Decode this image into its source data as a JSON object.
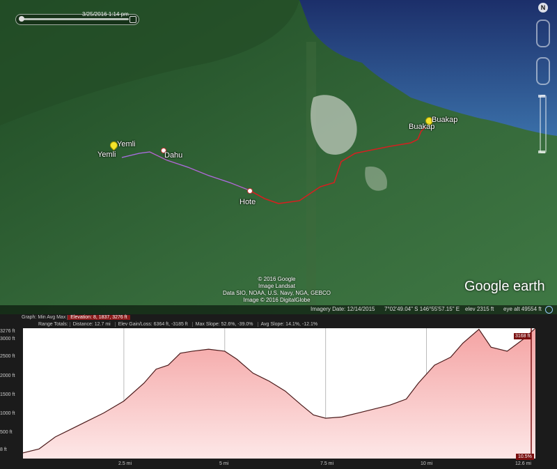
{
  "timeline": {
    "date": "3/25/2016",
    "time": "1:14 pm"
  },
  "nav": {
    "north": "N"
  },
  "places": {
    "yemli_top": "Yemli",
    "yemli_bottom": "Yemli",
    "dahu": "Dahu",
    "hote": "Hote",
    "buakap_top": "Buakap",
    "buakap_bottom": "Buakap"
  },
  "credits": [
    "© 2016 Google",
    "Image Landsat",
    "Data SIO, NOAA, U.S. Navy, NGA, GEBCO",
    "Image © 2016 DigitalGlobe"
  ],
  "logo": "Google earth",
  "status": {
    "imagery": "Imagery Date: 12/14/2015",
    "coords": "7°02'49.04\" S  146°55'57.15\" E",
    "elev": "elev  2315 ft",
    "eye": "eye alt  49554 ft"
  },
  "profile": {
    "row1": {
      "graph": "Graph:",
      "min": "Min",
      "avg": "Avg",
      "max": "Max",
      "elevation": "Elevation: 8, 1837, 3276 ft"
    },
    "row2": {
      "range": "Range Totals:",
      "distance": "Distance: 12.7 mi",
      "gain": "Elev Gain/Loss: 6364 ft, -3185 ft",
      "maxslope": "Max Slope: 52.6%, -39.0%",
      "avgslope": "Avg Slope: 14.1%, -12.1%"
    },
    "current_value": "3168 ft",
    "current_slope": "10.5%"
  },
  "chart_data": {
    "type": "area",
    "ylabel_ticks": [
      "3276 ft",
      "3000 ft",
      "2500 ft",
      "2000 ft",
      "1500 ft",
      "1000 ft",
      "500 ft",
      "8 ft"
    ],
    "xticks": [
      "2.5 mi",
      "5 mi",
      "7.5 mi",
      "10 mi",
      "12.6 mi"
    ],
    "ylim": [
      8,
      3276
    ],
    "xlim": [
      0,
      12.7
    ],
    "x": [
      0,
      0.4,
      0.8,
      1.2,
      1.6,
      2.0,
      2.5,
      3.0,
      3.3,
      3.6,
      3.9,
      4.2,
      4.6,
      5.0,
      5.3,
      5.7,
      6.1,
      6.5,
      6.9,
      7.2,
      7.5,
      7.9,
      8.3,
      8.7,
      9.1,
      9.5,
      9.8,
      10.2,
      10.6,
      10.9,
      11.3,
      11.6,
      12.0,
      12.4,
      12.7
    ],
    "y": [
      150,
      250,
      550,
      750,
      950,
      1150,
      1450,
      1900,
      2250,
      2350,
      2650,
      2700,
      2750,
      2700,
      2500,
      2150,
      1950,
      1700,
      1350,
      1100,
      1020,
      1050,
      1150,
      1250,
      1350,
      1500,
      1900,
      2350,
      2550,
      2900,
      3250,
      2800,
      2700,
      3000,
      3276
    ]
  }
}
